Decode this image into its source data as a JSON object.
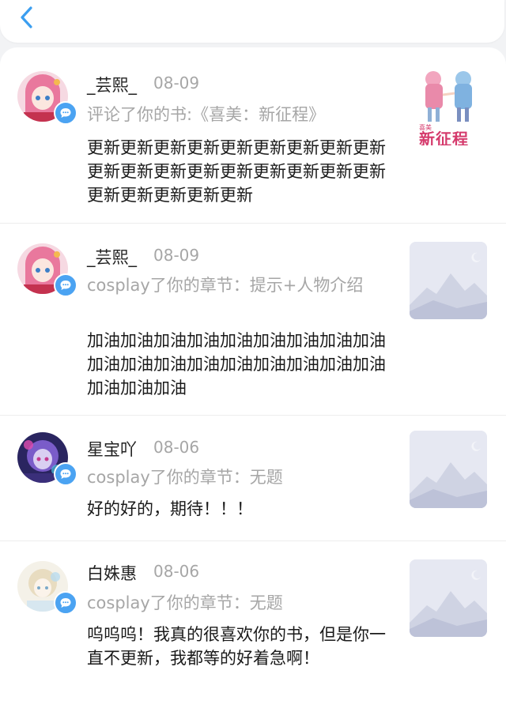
{
  "nav": {
    "back_icon": "chevron-left-icon"
  },
  "colors": {
    "accent": "#4ba3f2",
    "title_red": "#d53a6c",
    "placeholder_bg": "#e6e8f2"
  },
  "notifications": [
    {
      "user": "_芸熙_",
      "date": "08-09",
      "action": "评论了你的书:《喜美：新征程》",
      "content": "更新更新更新更新更新更新更新更新更新更新更新更新更新更新更新更新更新更新更新更新更新更新更新",
      "thumb_title": "新征程",
      "thumb_subtitle": "喜美"
    },
    {
      "user": "_芸熙_",
      "date": "08-09",
      "action": "cosplay了你的章节：提示+人物介绍",
      "content": "加油加油加油加油加油加油加油加油加油加油加油加油加油加油加油加油加油加油加油加油加油"
    },
    {
      "user": "星宝吖",
      "date": "08-06",
      "action": "cosplay了你的章节：无题",
      "content": "好的好的，期待！！！"
    },
    {
      "user": "白姝惠",
      "date": "08-06",
      "action": "cosplay了你的章节：无题",
      "content": "呜呜呜！我真的很喜欢你的书，但是你一直不更新，我都等的好着急啊！"
    }
  ]
}
